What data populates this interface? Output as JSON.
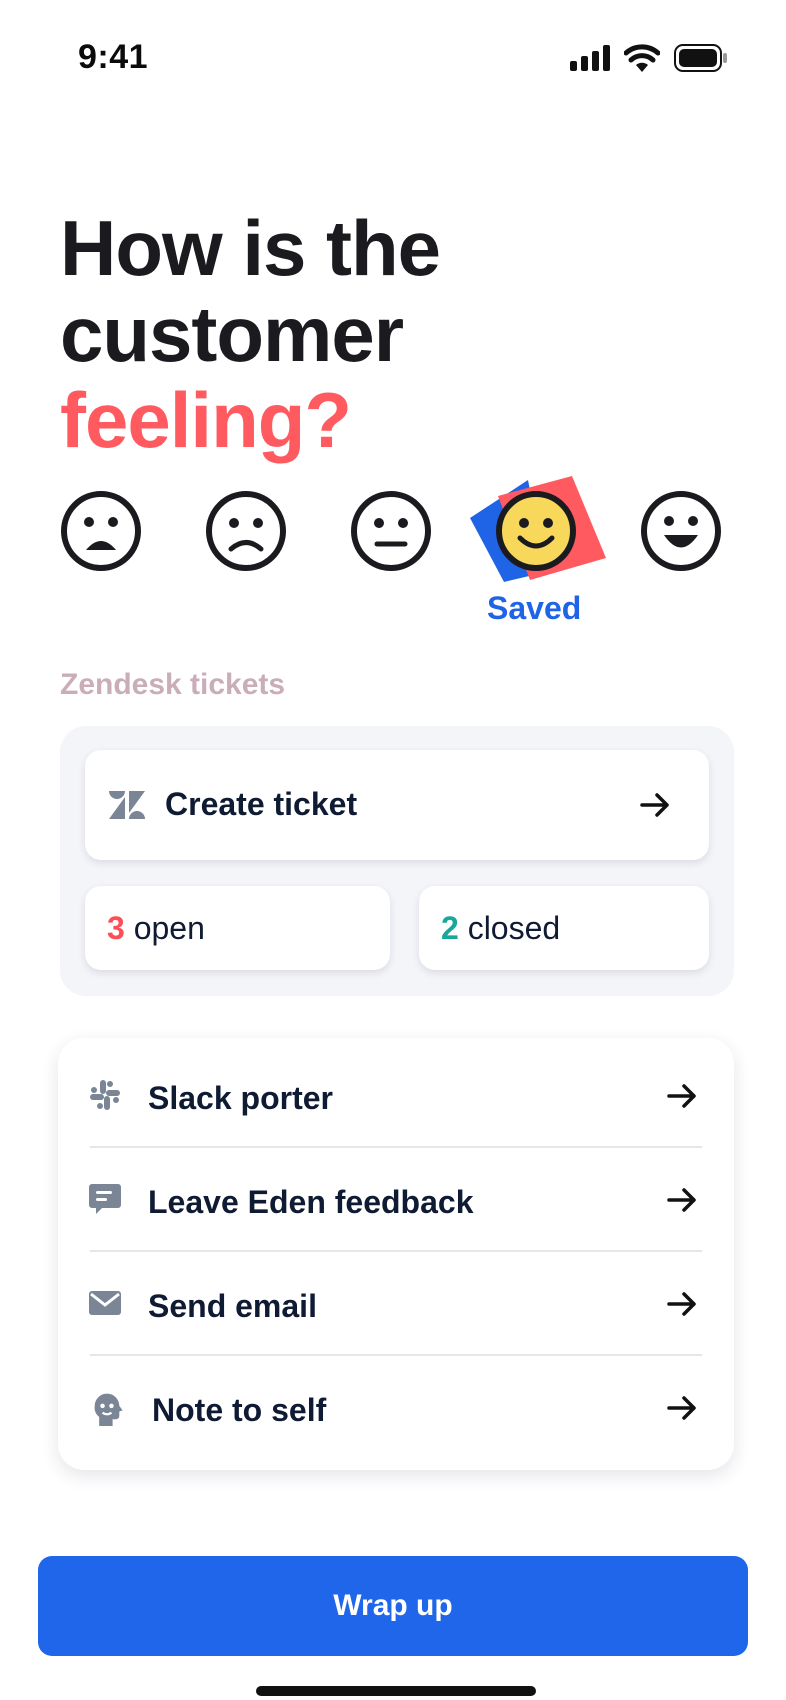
{
  "status_bar": {
    "time": "9:41"
  },
  "heading": {
    "line1": "How is the",
    "line2": "customer",
    "line3": "feeling?",
    "accent_color": "#ff5a5f"
  },
  "moods": {
    "options": [
      "very-unhappy-face-icon",
      "sad-face-icon",
      "neutral-face-icon",
      "happy-face-icon",
      "very-happy-face-icon"
    ],
    "selected_index": 3,
    "saved_label": "Saved"
  },
  "zendesk": {
    "section_label": "Zendesk tickets",
    "create_label": "Create ticket",
    "open_count": "3",
    "open_label": "open",
    "closed_count": "2",
    "closed_label": "closed"
  },
  "actions": [
    {
      "label": "Slack porter",
      "icon": "slack-icon"
    },
    {
      "label": "Leave Eden feedback",
      "icon": "feedback-icon"
    },
    {
      "label": "Send email",
      "icon": "mail-icon"
    },
    {
      "label": "Note to self",
      "icon": "note-to-self-icon"
    }
  ],
  "footer": {
    "wrap_up_label": "Wrap up"
  },
  "colors": {
    "primary": "#1f66ea",
    "saved_text": "#1f64e6",
    "open_count": "#ff4d57",
    "closed_count": "#18a79b",
    "selected_face": "#f8d85a"
  }
}
